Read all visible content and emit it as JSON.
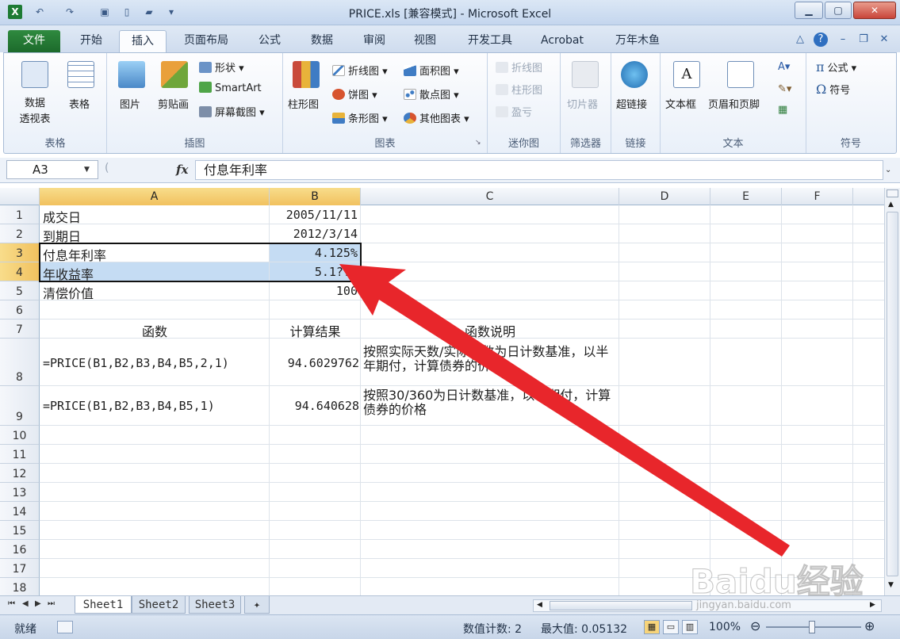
{
  "window": {
    "title": "PRICE.xls  [兼容模式] - Microsoft Excel",
    "app_icon": "X",
    "qat_icons": [
      "undo-icon",
      "redo-icon",
      "save-icon",
      "new-icon",
      "open-icon",
      "customize-icon"
    ]
  },
  "tabs": [
    "文件",
    "开始",
    "插入",
    "页面布局",
    "公式",
    "数据",
    "审阅",
    "视图",
    "开发工具",
    "Acrobat",
    "万年木鱼"
  ],
  "ribbon": {
    "groups": [
      {
        "label": "表格",
        "buttons": [
          "数据\n透视表",
          "表格"
        ]
      },
      {
        "label": "插图",
        "buttons": [
          "图片",
          "剪贴画",
          "形状",
          "SmartArt",
          "屏幕截图"
        ]
      },
      {
        "label": "图表",
        "buttons": [
          "柱形图",
          "折线图",
          "饼图",
          "条形图",
          "面积图",
          "散点图",
          "其他图表"
        ]
      },
      {
        "label": "迷你图",
        "buttons": [
          "折线图",
          "柱形图",
          "盈亏"
        ]
      },
      {
        "label": "筛选器",
        "buttons": [
          "切片器"
        ]
      },
      {
        "label": "链接",
        "buttons": [
          "超链接"
        ]
      },
      {
        "label": "文本",
        "buttons": [
          "文本框",
          "页眉和页脚"
        ]
      },
      {
        "label": "符号",
        "buttons": [
          "公式",
          "符号"
        ]
      }
    ]
  },
  "formula_bar": {
    "name_box": "A3",
    "fx": "fx",
    "formula": "付息年利率"
  },
  "columns": [
    "A",
    "B",
    "C",
    "D",
    "E",
    "F"
  ],
  "rows": [
    "1",
    "2",
    "3",
    "4",
    "5",
    "6",
    "7",
    "8",
    "9",
    "10",
    "11",
    "12",
    "13",
    "14",
    "15",
    "16",
    "17",
    "18"
  ],
  "cells": {
    "A1": "成交日",
    "B1": "2005/11/11",
    "A2": "到期日",
    "B2": "2012/3/14",
    "A3": "付息年利率",
    "B3": "4.125%",
    "A4": "年收益率",
    "B4": "5.1??%",
    "A5": "清偿价值",
    "B5": "100",
    "A7": "函数",
    "B7": "计算结果",
    "C7": "函数说明",
    "A8": "=PRICE(B1,B2,B3,B4,B5,2,1)",
    "B8": "94.6029762",
    "C8": "按照实际天数/实际天数为日计数基准，以半年期付，计算债券的价格",
    "A9": "=PRICE(B1,B2,B3,B4,B5,1)",
    "B9": "94.640628",
    "C9": "按照30/360为日计数基准，以年期付，计算债券的价格"
  },
  "sheets": [
    "Sheet1",
    "Sheet2",
    "Sheet3"
  ],
  "status": {
    "ready": "就绪",
    "count": "数值计数: 2",
    "max": "最大值: 0.05132",
    "zoom": "100%"
  },
  "annotation": {
    "arrow_color": "#e8262b"
  },
  "watermark": {
    "brand": "Baidu经验",
    "url": "jingyan.baidu.com"
  }
}
